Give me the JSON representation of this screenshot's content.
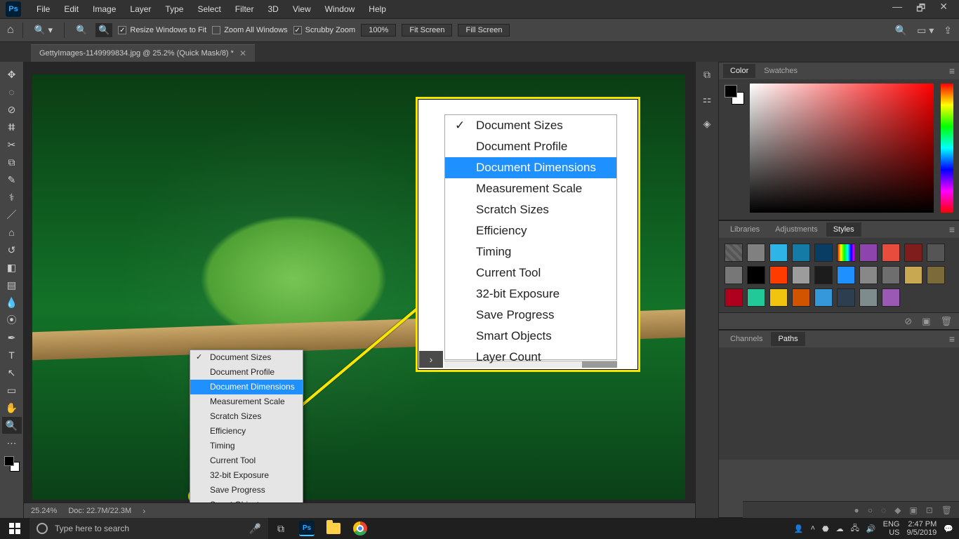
{
  "app": {
    "logo": "Ps"
  },
  "menubar": [
    "File",
    "Edit",
    "Image",
    "Layer",
    "Type",
    "Select",
    "Filter",
    "3D",
    "View",
    "Window",
    "Help"
  ],
  "titlebar_controls": {
    "min": "—",
    "restore": "🗗",
    "close": "✕"
  },
  "optbar": {
    "resize_to_fit": "Resize Windows to Fit",
    "zoom_all": "Zoom All Windows",
    "scrubby": "Scrubby Zoom",
    "pct": "100%",
    "fit": "Fit Screen",
    "fill": "Fill Screen"
  },
  "doctab": {
    "title": "GettyImages-1149999834.jpg @ 25.2% (Quick Mask/8) *"
  },
  "status": {
    "zoom": "25.24%",
    "doc": "Doc: 22.7M/22.3M",
    "chev": "›"
  },
  "context_menu": {
    "items": [
      {
        "label": "Document Sizes",
        "checked": true,
        "selected": false
      },
      {
        "label": "Document Profile",
        "checked": false,
        "selected": false
      },
      {
        "label": "Document Dimensions",
        "checked": false,
        "selected": true
      },
      {
        "label": "Measurement Scale",
        "checked": false,
        "selected": false
      },
      {
        "label": "Scratch Sizes",
        "checked": false,
        "selected": false
      },
      {
        "label": "Efficiency",
        "checked": false,
        "selected": false
      },
      {
        "label": "Timing",
        "checked": false,
        "selected": false
      },
      {
        "label": "Current Tool",
        "checked": false,
        "selected": false
      },
      {
        "label": "32-bit Exposure",
        "checked": false,
        "selected": false
      },
      {
        "label": "Save Progress",
        "checked": false,
        "selected": false
      },
      {
        "label": "Smart Objects",
        "checked": false,
        "selected": false
      },
      {
        "label": "Layer Count",
        "checked": false,
        "selected": false
      }
    ]
  },
  "right_panels": {
    "color_tabs": [
      "Color",
      "Swatches"
    ],
    "styles_tabs": [
      "Libraries",
      "Adjustments",
      "Styles"
    ],
    "paths_tabs": [
      "Channels",
      "Paths"
    ]
  },
  "style_swatches": [
    "#ffffff00",
    "#808080",
    "#2fb4e8",
    "#147ba6",
    "#0a3d63",
    "#ff7f00ff",
    "#8e44ad",
    "#e74c3c",
    "#7f1d1d",
    "#555555",
    "#777777",
    "#000000",
    "#ff3b00",
    "#9c9c9c",
    "#1c1c1c",
    "#1e90ff",
    "#888888",
    "#6e6e6e",
    "#c8a951",
    "#7c6a3a",
    "#b00020",
    "#20c997",
    "#f1c40f",
    "#d35400",
    "#3498db",
    "#2c3e50",
    "#7f8c8d",
    "#9b59b6"
  ],
  "taskbar": {
    "search_placeholder": "Type here to search",
    "lang1": "ENG",
    "lang2": "US",
    "time": "2:47 PM",
    "date": "9/5/2019"
  }
}
